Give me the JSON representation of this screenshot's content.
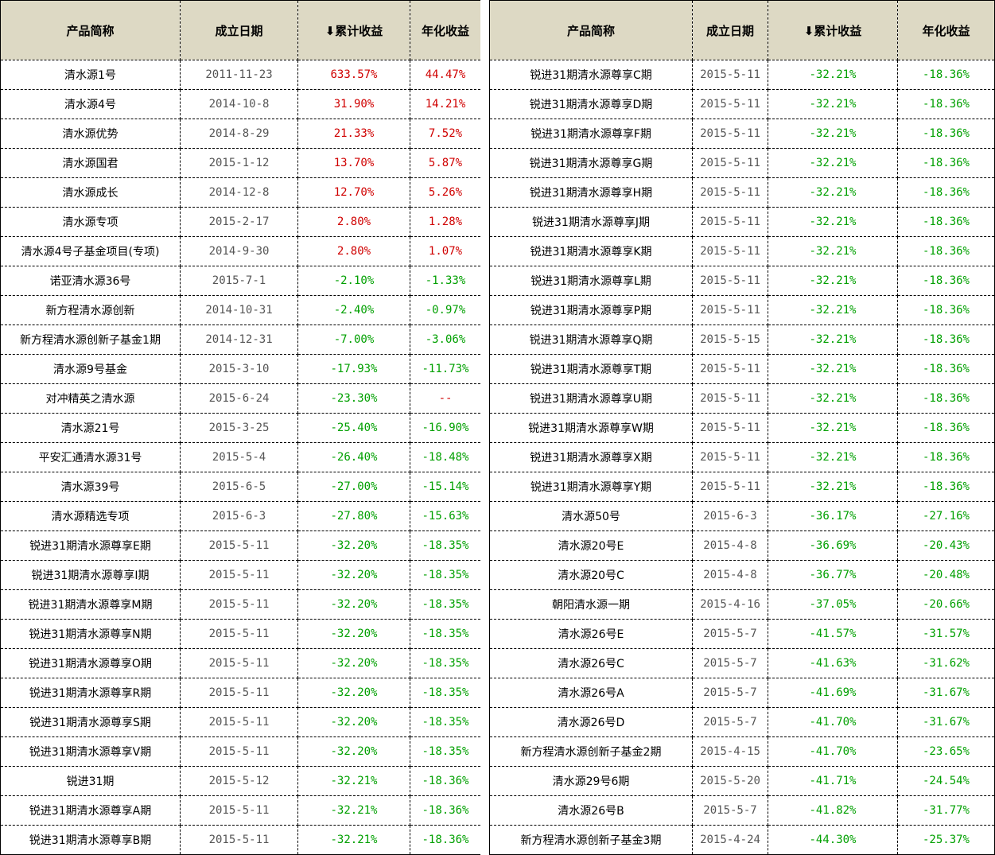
{
  "left_table": {
    "headers": [
      "产品简称",
      "成立日期",
      "⬇累计收益",
      "年化收益"
    ],
    "rows": [
      {
        "name": "清水源1号",
        "date": "2011-11-23",
        "cum": "633.57%",
        "ann": "44.47%",
        "cum_sign": "pos",
        "ann_sign": "pos"
      },
      {
        "name": "清水源4号",
        "date": "2014-10-8",
        "cum": "31.90%",
        "ann": "14.21%",
        "cum_sign": "pos",
        "ann_sign": "pos"
      },
      {
        "name": "清水源优势",
        "date": "2014-8-29",
        "cum": "21.33%",
        "ann": "7.52%",
        "cum_sign": "pos",
        "ann_sign": "pos"
      },
      {
        "name": "清水源国君",
        "date": "2015-1-12",
        "cum": "13.70%",
        "ann": "5.87%",
        "cum_sign": "pos",
        "ann_sign": "pos"
      },
      {
        "name": "清水源成长",
        "date": "2014-12-8",
        "cum": "12.70%",
        "ann": "5.26%",
        "cum_sign": "pos",
        "ann_sign": "pos"
      },
      {
        "name": "清水源专项",
        "date": "2015-2-17",
        "cum": "2.80%",
        "ann": "1.28%",
        "cum_sign": "pos",
        "ann_sign": "pos"
      },
      {
        "name": "清水源4号子基金项目(专项)",
        "date": "2014-9-30",
        "cum": "2.80%",
        "ann": "1.07%",
        "cum_sign": "pos",
        "ann_sign": "pos"
      },
      {
        "name": "诺亚清水源36号",
        "date": "2015-7-1",
        "cum": "-2.10%",
        "ann": "-1.33%",
        "cum_sign": "neg",
        "ann_sign": "neg"
      },
      {
        "name": "新方程清水源创新",
        "date": "2014-10-31",
        "cum": "-2.40%",
        "ann": "-0.97%",
        "cum_sign": "neg",
        "ann_sign": "neg"
      },
      {
        "name": "新方程清水源创新子基金1期",
        "date": "2014-12-31",
        "cum": "-7.00%",
        "ann": "-3.06%",
        "cum_sign": "neg",
        "ann_sign": "neg"
      },
      {
        "name": "清水源9号基金",
        "date": "2015-3-10",
        "cum": "-17.93%",
        "ann": "-11.73%",
        "cum_sign": "neg",
        "ann_sign": "neg"
      },
      {
        "name": "对冲精英之清水源",
        "date": "2015-6-24",
        "cum": "-23.30%",
        "ann": "--",
        "cum_sign": "neg",
        "ann_sign": "pos"
      },
      {
        "name": "清水源21号",
        "date": "2015-3-25",
        "cum": "-25.40%",
        "ann": "-16.90%",
        "cum_sign": "neg",
        "ann_sign": "neg"
      },
      {
        "name": "平安汇通清水源31号",
        "date": "2015-5-4",
        "cum": "-26.40%",
        "ann": "-18.48%",
        "cum_sign": "neg",
        "ann_sign": "neg"
      },
      {
        "name": "清水源39号",
        "date": "2015-6-5",
        "cum": "-27.00%",
        "ann": "-15.14%",
        "cum_sign": "neg",
        "ann_sign": "neg"
      },
      {
        "name": "清水源精选专项",
        "date": "2015-6-3",
        "cum": "-27.80%",
        "ann": "-15.63%",
        "cum_sign": "neg",
        "ann_sign": "neg"
      },
      {
        "name": "锐进31期清水源尊享E期",
        "date": "2015-5-11",
        "cum": "-32.20%",
        "ann": "-18.35%",
        "cum_sign": "neg",
        "ann_sign": "neg"
      },
      {
        "name": "锐进31期清水源尊享I期",
        "date": "2015-5-11",
        "cum": "-32.20%",
        "ann": "-18.35%",
        "cum_sign": "neg",
        "ann_sign": "neg"
      },
      {
        "name": "锐进31期清水源尊享M期",
        "date": "2015-5-11",
        "cum": "-32.20%",
        "ann": "-18.35%",
        "cum_sign": "neg",
        "ann_sign": "neg"
      },
      {
        "name": "锐进31期清水源尊享N期",
        "date": "2015-5-11",
        "cum": "-32.20%",
        "ann": "-18.35%",
        "cum_sign": "neg",
        "ann_sign": "neg"
      },
      {
        "name": "锐进31期清水源尊享O期",
        "date": "2015-5-11",
        "cum": "-32.20%",
        "ann": "-18.35%",
        "cum_sign": "neg",
        "ann_sign": "neg"
      },
      {
        "name": "锐进31期清水源尊享R期",
        "date": "2015-5-11",
        "cum": "-32.20%",
        "ann": "-18.35%",
        "cum_sign": "neg",
        "ann_sign": "neg"
      },
      {
        "name": "锐进31期清水源尊享S期",
        "date": "2015-5-11",
        "cum": "-32.20%",
        "ann": "-18.35%",
        "cum_sign": "neg",
        "ann_sign": "neg"
      },
      {
        "name": "锐进31期清水源尊享V期",
        "date": "2015-5-11",
        "cum": "-32.20%",
        "ann": "-18.35%",
        "cum_sign": "neg",
        "ann_sign": "neg"
      },
      {
        "name": "锐进31期",
        "date": "2015-5-12",
        "cum": "-32.21%",
        "ann": "-18.36%",
        "cum_sign": "neg",
        "ann_sign": "neg"
      },
      {
        "name": "锐进31期清水源尊享A期",
        "date": "2015-5-11",
        "cum": "-32.21%",
        "ann": "-18.36%",
        "cum_sign": "neg",
        "ann_sign": "neg"
      },
      {
        "name": "锐进31期清水源尊享B期",
        "date": "2015-5-11",
        "cum": "-32.21%",
        "ann": "-18.36%",
        "cum_sign": "neg",
        "ann_sign": "neg"
      }
    ]
  },
  "right_table": {
    "headers": [
      "产品简称",
      "成立日期",
      "⬇累计收益",
      "年化收益"
    ],
    "rows": [
      {
        "name": "锐进31期清水源尊享C期",
        "date": "2015-5-11",
        "cum": "-32.21%",
        "ann": "-18.36%",
        "cum_sign": "neg",
        "ann_sign": "neg"
      },
      {
        "name": "锐进31期清水源尊享D期",
        "date": "2015-5-11",
        "cum": "-32.21%",
        "ann": "-18.36%",
        "cum_sign": "neg",
        "ann_sign": "neg"
      },
      {
        "name": "锐进31期清水源尊享F期",
        "date": "2015-5-11",
        "cum": "-32.21%",
        "ann": "-18.36%",
        "cum_sign": "neg",
        "ann_sign": "neg"
      },
      {
        "name": "锐进31期清水源尊享G期",
        "date": "2015-5-11",
        "cum": "-32.21%",
        "ann": "-18.36%",
        "cum_sign": "neg",
        "ann_sign": "neg"
      },
      {
        "name": "锐进31期清水源尊享H期",
        "date": "2015-5-11",
        "cum": "-32.21%",
        "ann": "-18.36%",
        "cum_sign": "neg",
        "ann_sign": "neg"
      },
      {
        "name": "锐进31期清水源尊享J期",
        "date": "2015-5-11",
        "cum": "-32.21%",
        "ann": "-18.36%",
        "cum_sign": "neg",
        "ann_sign": "neg"
      },
      {
        "name": "锐进31期清水源尊享K期",
        "date": "2015-5-11",
        "cum": "-32.21%",
        "ann": "-18.36%",
        "cum_sign": "neg",
        "ann_sign": "neg"
      },
      {
        "name": "锐进31期清水源尊享L期",
        "date": "2015-5-11",
        "cum": "-32.21%",
        "ann": "-18.36%",
        "cum_sign": "neg",
        "ann_sign": "neg"
      },
      {
        "name": "锐进31期清水源尊享P期",
        "date": "2015-5-11",
        "cum": "-32.21%",
        "ann": "-18.36%",
        "cum_sign": "neg",
        "ann_sign": "neg"
      },
      {
        "name": "锐进31期清水源尊享Q期",
        "date": "2015-5-15",
        "cum": "-32.21%",
        "ann": "-18.36%",
        "cum_sign": "neg",
        "ann_sign": "neg"
      },
      {
        "name": "锐进31期清水源尊享T期",
        "date": "2015-5-11",
        "cum": "-32.21%",
        "ann": "-18.36%",
        "cum_sign": "neg",
        "ann_sign": "neg"
      },
      {
        "name": "锐进31期清水源尊享U期",
        "date": "2015-5-11",
        "cum": "-32.21%",
        "ann": "-18.36%",
        "cum_sign": "neg",
        "ann_sign": "neg"
      },
      {
        "name": "锐进31期清水源尊享W期",
        "date": "2015-5-11",
        "cum": "-32.21%",
        "ann": "-18.36%",
        "cum_sign": "neg",
        "ann_sign": "neg"
      },
      {
        "name": "锐进31期清水源尊享X期",
        "date": "2015-5-11",
        "cum": "-32.21%",
        "ann": "-18.36%",
        "cum_sign": "neg",
        "ann_sign": "neg"
      },
      {
        "name": "锐进31期清水源尊享Y期",
        "date": "2015-5-11",
        "cum": "-32.21%",
        "ann": "-18.36%",
        "cum_sign": "neg",
        "ann_sign": "neg"
      },
      {
        "name": "清水源50号",
        "date": "2015-6-3",
        "cum": "-36.17%",
        "ann": "-27.16%",
        "cum_sign": "neg",
        "ann_sign": "neg"
      },
      {
        "name": "清水源20号E",
        "date": "2015-4-8",
        "cum": "-36.69%",
        "ann": "-20.43%",
        "cum_sign": "neg",
        "ann_sign": "neg"
      },
      {
        "name": "清水源20号C",
        "date": "2015-4-8",
        "cum": "-36.77%",
        "ann": "-20.48%",
        "cum_sign": "neg",
        "ann_sign": "neg"
      },
      {
        "name": "朝阳清水源一期",
        "date": "2015-4-16",
        "cum": "-37.05%",
        "ann": "-20.66%",
        "cum_sign": "neg",
        "ann_sign": "neg"
      },
      {
        "name": "清水源26号E",
        "date": "2015-5-7",
        "cum": "-41.57%",
        "ann": "-31.57%",
        "cum_sign": "neg",
        "ann_sign": "neg"
      },
      {
        "name": "清水源26号C",
        "date": "2015-5-7",
        "cum": "-41.63%",
        "ann": "-31.62%",
        "cum_sign": "neg",
        "ann_sign": "neg"
      },
      {
        "name": "清水源26号A",
        "date": "2015-5-7",
        "cum": "-41.69%",
        "ann": "-31.67%",
        "cum_sign": "neg",
        "ann_sign": "neg"
      },
      {
        "name": "清水源26号D",
        "date": "2015-5-7",
        "cum": "-41.70%",
        "ann": "-31.67%",
        "cum_sign": "neg",
        "ann_sign": "neg"
      },
      {
        "name": "新方程清水源创新子基金2期",
        "date": "2015-4-15",
        "cum": "-41.70%",
        "ann": "-23.65%",
        "cum_sign": "neg",
        "ann_sign": "neg"
      },
      {
        "name": "清水源29号6期",
        "date": "2015-5-20",
        "cum": "-41.71%",
        "ann": "-24.54%",
        "cum_sign": "neg",
        "ann_sign": "neg"
      },
      {
        "name": "清水源26号B",
        "date": "2015-5-7",
        "cum": "-41.82%",
        "ann": "-31.77%",
        "cum_sign": "neg",
        "ann_sign": "neg"
      },
      {
        "name": "新方程清水源创新子基金3期",
        "date": "2015-4-24",
        "cum": "-44.30%",
        "ann": "-25.37%",
        "cum_sign": "neg",
        "ann_sign": "neg"
      }
    ]
  },
  "colors": {
    "header_bg": "#ddd9c4",
    "positive": "#d00000",
    "negative": "#00a000",
    "date_text": "#555555"
  },
  "icons": {
    "sort_arrow": "down-arrow-icon"
  }
}
